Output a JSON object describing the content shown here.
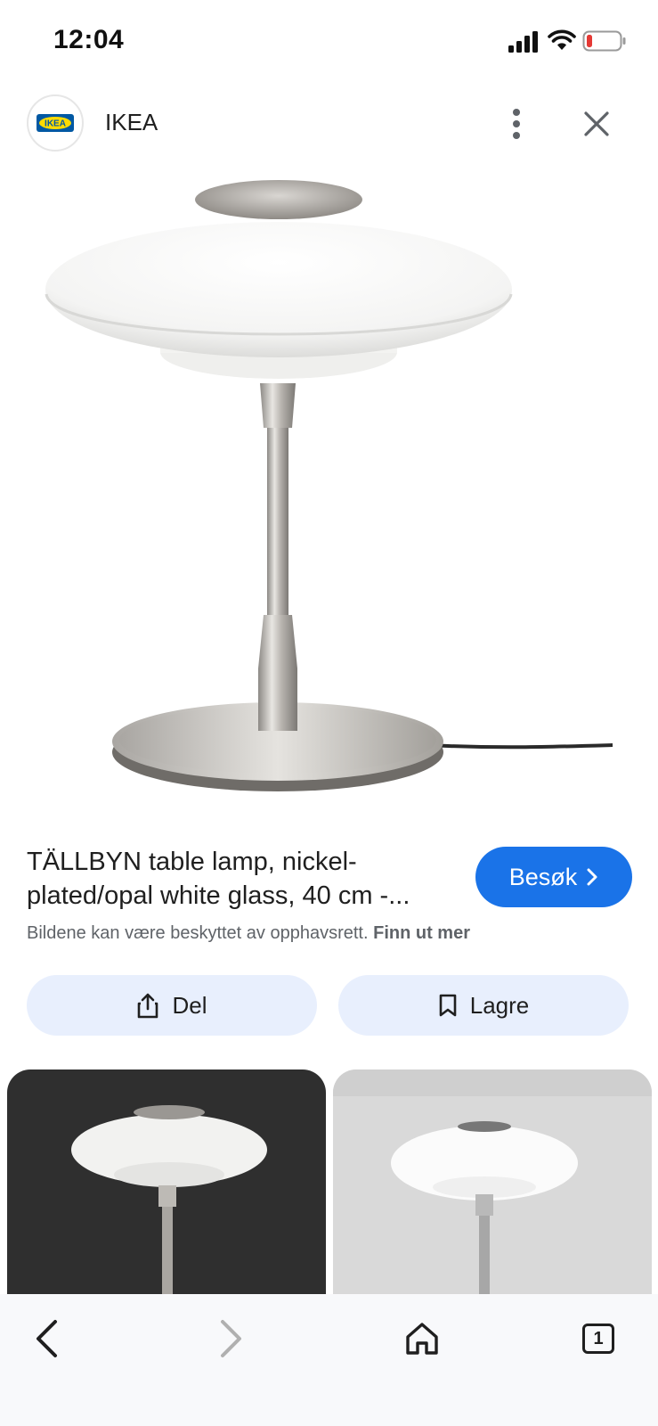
{
  "status_bar": {
    "time": "12:04"
  },
  "header": {
    "site_name": "IKEA",
    "logo_text": "IKEA"
  },
  "product": {
    "title_line1": "TÄLLBYN table lamp, nickel-",
    "title_line2": "plated/opal white glass, 40 cm -...",
    "visit_label": "Besøk",
    "copyright_text": "Bildene kan være beskyttet av opphavsrett.",
    "copyright_link": "Finn ut mer"
  },
  "actions": {
    "share_label": "Del",
    "save_label": "Lagre"
  },
  "nav": {
    "tab_count": "1"
  },
  "colors": {
    "accent": "#1a73e8",
    "action_bg": "#e8effd",
    "battery_low": "#e53935"
  }
}
